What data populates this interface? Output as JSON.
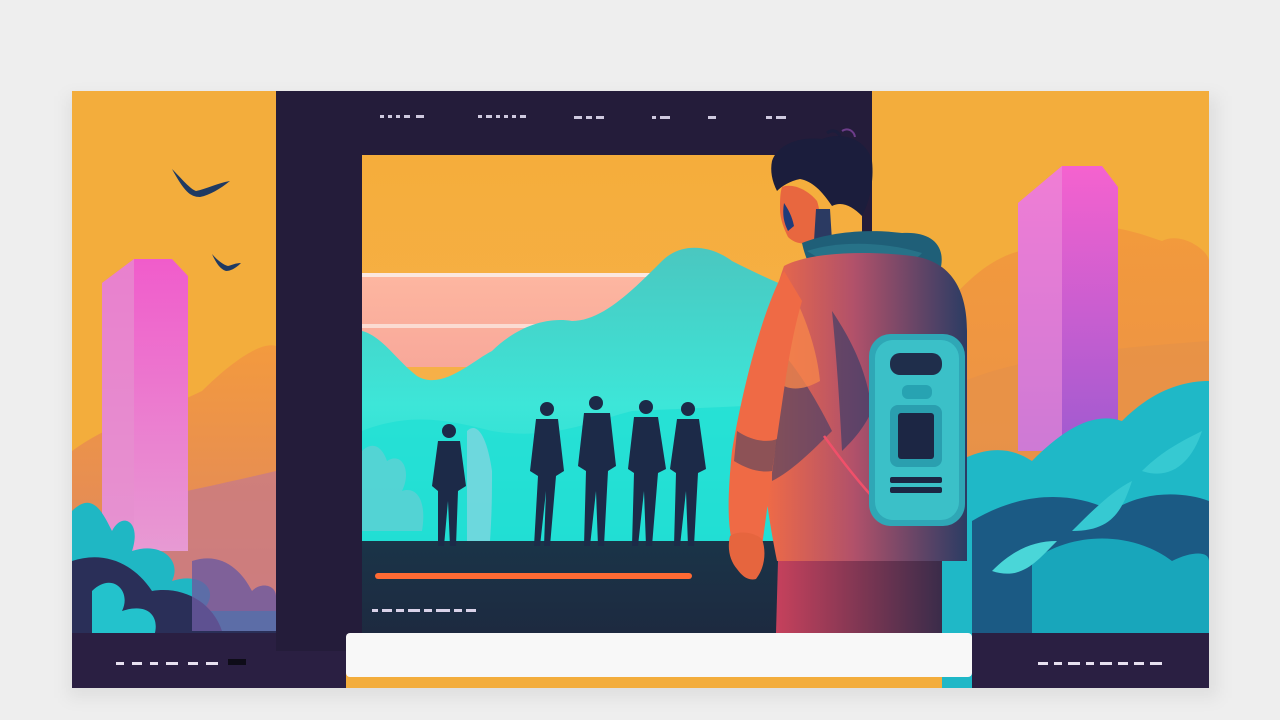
{
  "illustration": {
    "subject": "person-with-backpack-viewing-framed-landscape",
    "colors": {
      "background": "#eeeeee",
      "sky_orange": "#f2ab3a",
      "frame_dark": "#251d3c",
      "mountain_teal": "#2fe1d2",
      "pillar_pink": "#ea5cc8",
      "foliage_teal": "#1fb9c4"
    }
  }
}
